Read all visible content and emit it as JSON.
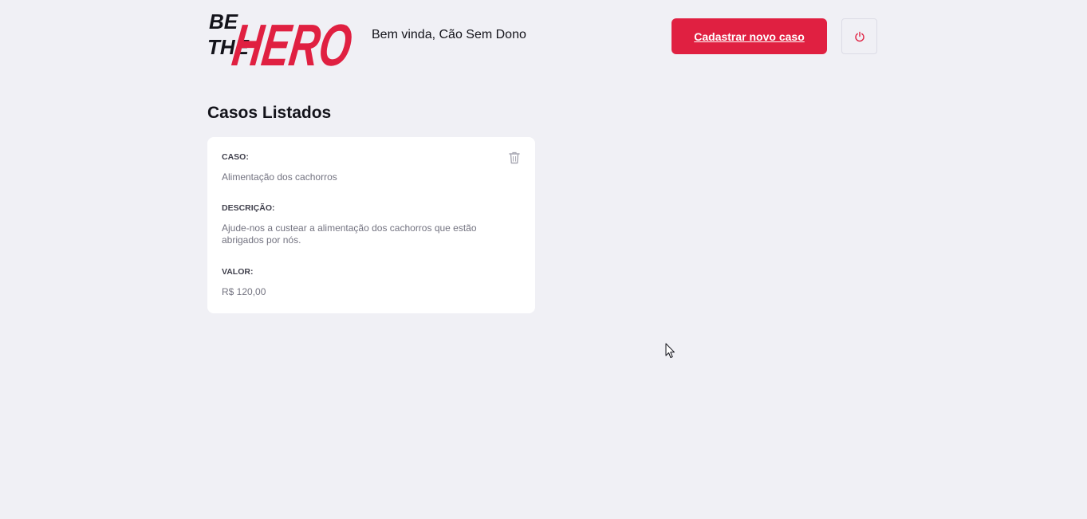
{
  "brand": {
    "logo_line1": "BE",
    "logo_line2": "THE",
    "logo_word": "HERO",
    "accent_color": "#e02041"
  },
  "header": {
    "welcome_text": "Bem vinda, Cão Sem Dono",
    "new_case_label": "Cadastrar novo caso",
    "logout_icon": "power-icon"
  },
  "main": {
    "title": "Casos Listados",
    "cases": [
      {
        "case_label": "CASO:",
        "case_value": "Alimentação dos cachorros",
        "description_label": "DESCRIÇÃO:",
        "description_value": "Ajude-nos a custear a alimentação dos cachorros que estão abrigados por nós.",
        "value_label": "VALOR:",
        "value_value": "R$ 120,00",
        "delete_icon": "trash-icon"
      }
    ]
  }
}
